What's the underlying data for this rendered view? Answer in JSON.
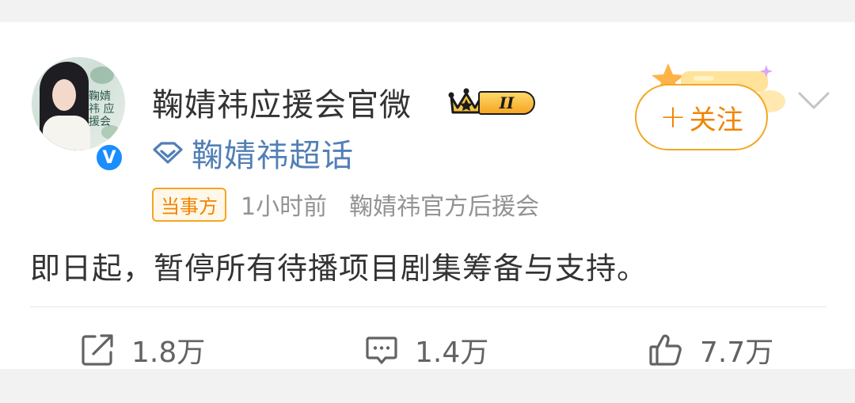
{
  "post": {
    "author": {
      "name": "鞠婧祎应援会官微",
      "avatar_text": "鞠婧祎 应援会",
      "verified_icon": "verified-v-icon",
      "level_badge": "II"
    },
    "topic": {
      "icon": "diamond-icon",
      "name": "鞠婧祎超话"
    },
    "meta": {
      "tag": "当事方",
      "time": "1小时前",
      "source": "鞠婧祎官方后援会"
    },
    "follow_button": {
      "plus": "+",
      "label": "关注"
    },
    "more_icon": "chevron-down-icon",
    "text": "即日起，暂停所有待播项目剧集筹备与支持。",
    "actions": {
      "repost": {
        "icon": "repost-icon",
        "count": "1.8万"
      },
      "comment": {
        "icon": "comment-icon",
        "count": "1.4万"
      },
      "like": {
        "icon": "thumbs-up-icon",
        "count": "7.7万"
      }
    }
  },
  "colors": {
    "accent_orange": "#f08400",
    "badge_gold": "#f5a623",
    "topic_blue": "#527fb7",
    "verified_blue": "#1a8dff"
  }
}
